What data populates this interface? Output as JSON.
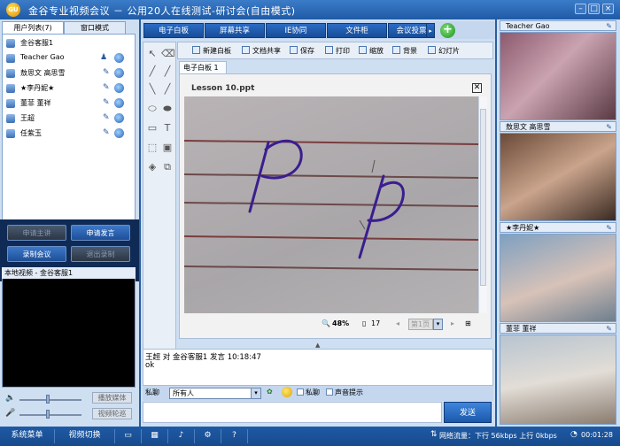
{
  "window": {
    "title": "金谷专业视频会议 － 公用20人在线测试-研讨会(自由模式)",
    "logo_text": "GU"
  },
  "left_tabs": [
    "用户列表(7)",
    "窗口模式"
  ],
  "users": [
    {
      "name": "金谷客服1"
    },
    {
      "name": "Teacher Gao"
    },
    {
      "name": "敖思文 高思雪"
    },
    {
      "name": "★李丹妮★"
    },
    {
      "name": "董菲 董祥"
    },
    {
      "name": "王超"
    },
    {
      "name": "任紫玉"
    }
  ],
  "controls": {
    "apply_host": "申请主讲",
    "apply_speak": "申请发言",
    "record": "录制会议",
    "exit_rec": "退出录制"
  },
  "local_video": {
    "title": "本地视频 - 金谷客服1",
    "play_media": "播放媒体",
    "video_rotate": "视频轮巡"
  },
  "menu": [
    "电子白板",
    "屏幕共享",
    "IE协同",
    "文件柜",
    "会议投票"
  ],
  "plus_symbol": "+",
  "toolbar": [
    "新建白板",
    "文档共享",
    "保存",
    "打印",
    "缩放",
    "背景",
    "幻灯片"
  ],
  "doc": {
    "tab": "电子白板 1",
    "name": "Lesson 10.ppt",
    "close": "✕",
    "zoom": "48%",
    "pages": "17",
    "page_select": "第1页"
  },
  "chat": {
    "line1": "王超  对  金谷客服1  发言  10:18:47",
    "line2": "ok",
    "to_label": "私聊",
    "to_value": "所有人",
    "private": "私聊",
    "sound": "声音提示",
    "send": "发送"
  },
  "videos": [
    {
      "name": "Teacher Gao"
    },
    {
      "name": "敖思文 高思雪"
    },
    {
      "name": "★李丹妮★"
    },
    {
      "name": "董菲 董祥"
    }
  ],
  "statusbar": {
    "system_menu": "系统菜单",
    "video_switch": "视频切换",
    "network": "网络流量：下行  56kbps  上行  0kbps",
    "time": "00:01:28"
  }
}
